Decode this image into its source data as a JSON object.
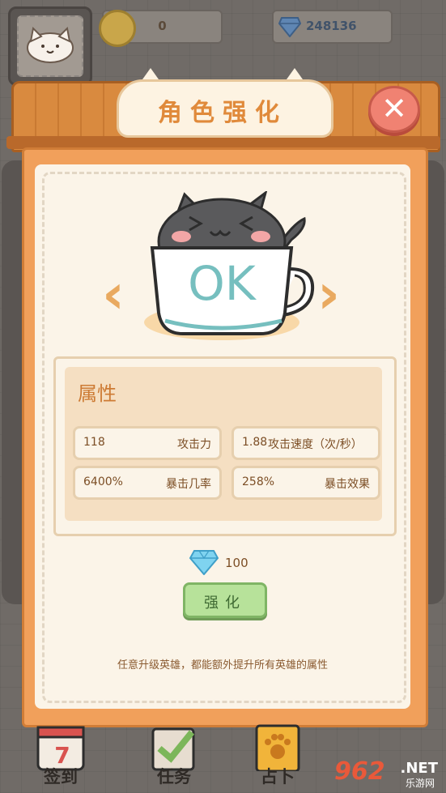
{
  "hud": {
    "coins": "0",
    "gems": "248136"
  },
  "panel": {
    "title": "角色强化",
    "close_label": "✕"
  },
  "nav_arrows": {
    "prev": "‹",
    "next": "›"
  },
  "mascot": {
    "cup_text": "OK"
  },
  "attributes": {
    "title": "属性",
    "stats": [
      {
        "value": "118",
        "label": "攻击力"
      },
      {
        "value": "1.88",
        "label": "攻击速度（次/秒）"
      },
      {
        "value": "6400%",
        "label": "暴击几率"
      },
      {
        "value": "258%",
        "label": "暴击效果"
      }
    ]
  },
  "upgrade": {
    "cost": "100",
    "button_label": "强化",
    "hint": "任意升级英雄，都能额外提升所有英雄的属性"
  },
  "bottom_nav": {
    "items": [
      {
        "label": "签到",
        "icon": "calendar-icon"
      },
      {
        "label": "任务",
        "icon": "checklist-icon"
      },
      {
        "label": "占卜",
        "icon": "paw-card-icon"
      }
    ]
  },
  "watermark": {
    "brand": "962",
    "suffix": ".NET",
    "sub": "乐游网"
  }
}
